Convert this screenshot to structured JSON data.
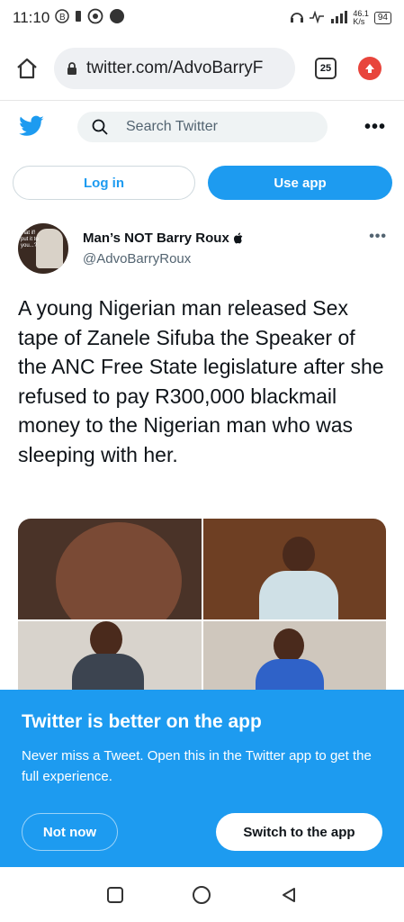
{
  "status_bar": {
    "time": "11:10",
    "network_speed": "46.1\nK/s",
    "battery": "94"
  },
  "browser": {
    "url": "twitter.com/AdvoBarryF",
    "tab_count": "25"
  },
  "twitter_header": {
    "search_placeholder": "Search Twitter",
    "more": "•••"
  },
  "auth": {
    "login_label": "Log in",
    "use_app_label": "Use app"
  },
  "tweet": {
    "author_name": "Man’s NOT Barry Roux",
    "author_handle": "@AdvoBarryRoux",
    "avatar_text": "that if! put it to you...?",
    "more": "•••",
    "text": "A young Nigerian man released Sex tape of Zanele Sifuba the Speaker of the ANC Free State legislature after she refused to pay R300,000 blackmail money to the Nigerian man who was sleeping with her."
  },
  "promo": {
    "title": "Twitter is better on the app",
    "text": "Never miss a Tweet. Open this in the Twitter app to get the full experience.",
    "not_now_label": "Not now",
    "switch_label": "Switch to the app"
  },
  "colors": {
    "twitter_blue": "#1d9bf0",
    "text": "#0f1419",
    "secondary_text": "#536471"
  },
  "icons": [
    "home-icon",
    "lock-icon",
    "upload-icon",
    "twitter-bird-icon",
    "search-icon",
    "apple-icon",
    "square-nav-icon",
    "circle-nav-icon",
    "back-nav-icon"
  ]
}
